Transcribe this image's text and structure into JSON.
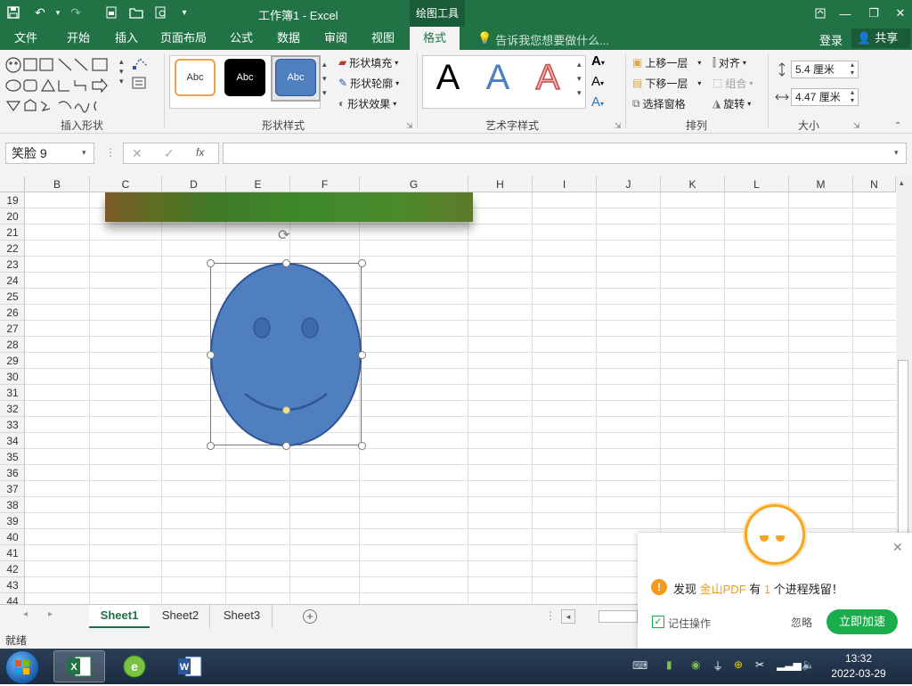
{
  "app": {
    "title": "工作簿1 - Excel",
    "context_tab": "绘图工具",
    "account": "登录",
    "share": "共享"
  },
  "tabs": [
    "文件",
    "开始",
    "插入",
    "页面布局",
    "公式",
    "数据",
    "审阅",
    "视图",
    "格式"
  ],
  "tell_me": "告诉我您想要做什么...",
  "ribbon": {
    "insert_shapes": {
      "label": "插入形状"
    },
    "shape_styles": {
      "label": "形状样式",
      "swatches": [
        "Abc",
        "Abc",
        "Abc"
      ],
      "fill": "形状填充",
      "outline": "形状轮廓",
      "effects": "形状效果"
    },
    "wordart": {
      "label": "艺术字样式",
      "letters": [
        "A",
        "A",
        "A"
      ]
    },
    "arrange": {
      "label": "排列",
      "bring_forward": "上移一层",
      "send_backward": "下移一层",
      "selection_pane": "选择窗格",
      "align": "对齐",
      "group": "组合",
      "rotate": "旋转"
    },
    "size": {
      "label": "大小",
      "height": "5.4 厘米",
      "width": "4.47 厘米"
    }
  },
  "formula": {
    "name_box": "笑脸 9",
    "fx": "fx",
    "value": ""
  },
  "columns": [
    "B",
    "C",
    "D",
    "E",
    "F",
    "G",
    "H",
    "I",
    "J",
    "K",
    "L",
    "M",
    "N"
  ],
  "rows": [
    "19",
    "20",
    "21",
    "22",
    "23",
    "24",
    "25",
    "26",
    "27",
    "28",
    "29",
    "30",
    "31",
    "32",
    "33",
    "34",
    "35",
    "36",
    "37",
    "38",
    "39",
    "40",
    "41",
    "42",
    "43",
    "44"
  ],
  "sheets": [
    "Sheet1",
    "Sheet2",
    "Sheet3"
  ],
  "status": "就绪",
  "popup": {
    "msg_pre": "发现",
    "msg_app": "金山PDF",
    "msg_mid": "有",
    "msg_num": "1",
    "msg_post": "个进程残留！",
    "remember": "记住操作",
    "ignore": "忽略",
    "accelerate": "立即加速"
  },
  "clock": {
    "time": "13:32",
    "date": "2022-03-29"
  },
  "colors": {
    "excel_green": "#217346",
    "smiley_fill": "#4f7fbf",
    "accent_green": "#1aad4b",
    "accent_orange": "#f39a1e"
  }
}
